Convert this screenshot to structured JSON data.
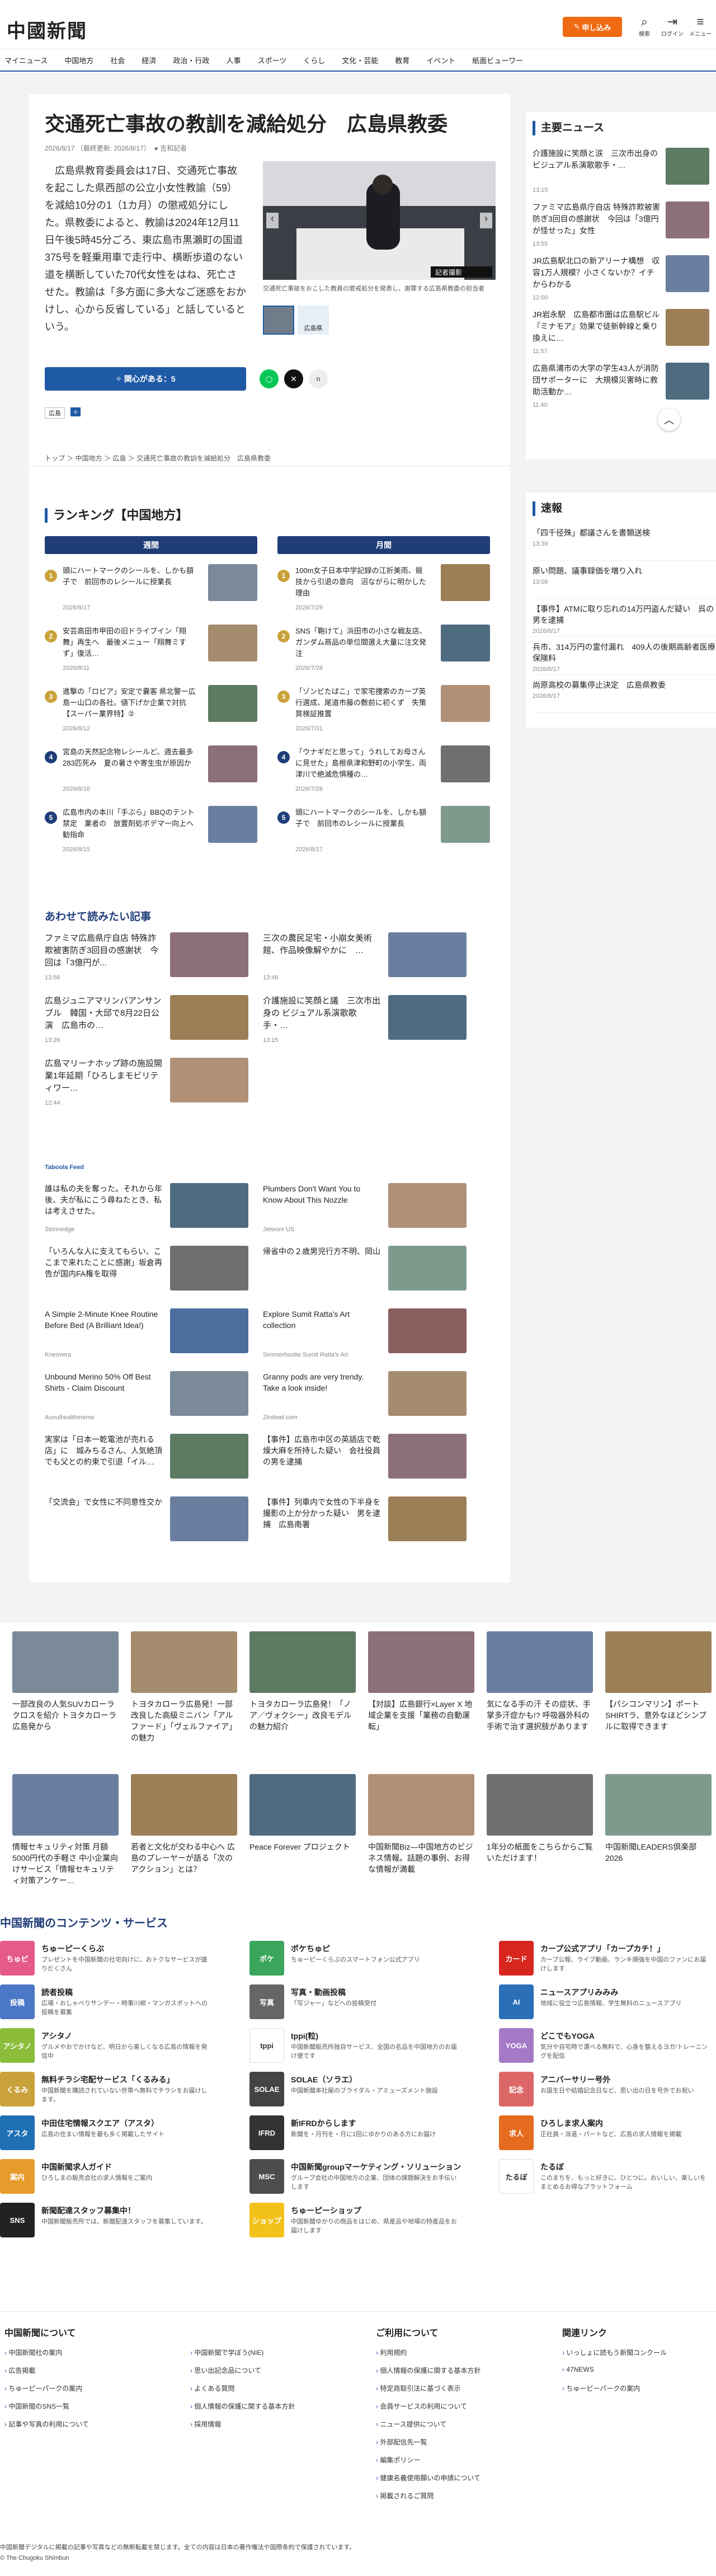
{
  "header": {
    "logo": "中國新聞",
    "subscribe": "申し込み",
    "icons": [
      {
        "glyph": "⌕",
        "label": "検索"
      },
      {
        "glyph": "⇥",
        "label": "ログイン"
      },
      {
        "glyph": "≡",
        "label": "メニュー"
      }
    ]
  },
  "nav": [
    "マイニュース",
    "中国地方",
    "社会",
    "経済",
    "政治・行政",
    "人事",
    "スポーツ",
    "くらし",
    "文化・芸能",
    "教育",
    "イベント",
    "紙面ビューワー"
  ],
  "article": {
    "title": "交通死亡事故の教訓を減給処分　広島県教委",
    "date": "2026/8/17",
    "updated": "（最終更新: 2026/8/17）",
    "author": "吉和記者",
    "body": "広島県教育委員会は17日、交通死亡事故を起こした県西部の公立小女性教諭（59）を減給10分の1（1カ月）の懲戒処分にした。県教委によると、教諭は2024年12月11日午後5時45分ごろ、東広島市黒瀬町の国道375号を軽乗用車で走行中、横断歩道のない道を横断していた70代女性をはね、死亡させた。教諭は「多方面に多大なご迷惑をおかけし、心から反省している」と話しているという。",
    "photo_credit": "記者撮影",
    "caption": "交通死亡事故をおこした教員の懲戒処分を発表し、謝罪する広島県教委の担当者",
    "thumb_label": "広島県",
    "like_label": "関心がある：5",
    "tag_badge": "広島"
  },
  "breadcrumb": "トップ ＞ 中国地方 ＞ 広島 ＞ 交通死亡事故の教訓を減給処分　広島県教委",
  "ranking": {
    "title": "ランキング【中国地方】",
    "col1": "週間",
    "col2": "月間",
    "weekly": [
      {
        "t": "頭にハートマークのシールを、しかも額子で　前回市のレシールに授業長",
        "d": "2026/8/17"
      },
      {
        "t": "安芸高田市甲田の旧ドライブイン「翔舞」再生へ　最後メニュー「翔舞ミすず」復活…",
        "d": "2026/8/11"
      },
      {
        "t": "進撃の「ロピア」安定で嚢客 県北警ー広島ー山口の各社。値下げか企業で対抗【スーパー業界特】②",
        "d": "2026/8/12"
      },
      {
        "t": "宮島の天然記念物レシールど、週去最多283匹死み　夏の暑さや寄生虫が原因か",
        "d": "2026/8/16"
      },
      {
        "t": "広島市内の本川「手ぶら」BBQのテント禁定　業者の　放置剤処ボデマ一向上へ勧指命",
        "d": "2026/8/15"
      }
    ],
    "monthly": [
      {
        "t": "100m女子日本中学記録の江折美雨、競技から引退の意向　沼ながらに明かした理由",
        "d": "2026/7/29"
      },
      {
        "t": "SNS「鞄けて」浜田市の小さな戦友店、ガンダム商品の単位間選え大量に注文発注",
        "d": "2026/7/28"
      },
      {
        "t": "「ゾンビたばこ」で家宅捜索のカープ英行選成、尾道市藤の敷前に初くず　失策質検証推置",
        "d": "2026/7/31"
      },
      {
        "t": "「ウナギだと思って」うれしてお母さんに見せた」島根県津和野町の小学生、両津川で絶滅危惧種の…",
        "d": "2026/7/26"
      },
      {
        "t": "頭にハートマークのシールを、しかも額子で　前回市のレシールに授業長",
        "d": "2026/8/17"
      }
    ]
  },
  "related": {
    "title": "あわせて読みたい記事",
    "items": [
      {
        "t": "ファミマ広島県庁自店 特殊詐欺被害防ぎ3回目の感謝状　今回は「3億円が...",
        "d": "13:56"
      },
      {
        "t": "三次の農民足宅・小崩女美術館、作品映像解やかに　…",
        "d": "13:46"
      },
      {
        "t": "広島ジュニアマリンバアンサンブル　韓国・大邱で8月22日公演　広島市の…",
        "d": "13:26"
      },
      {
        "t": "介護施設に笑顔と議　三次市出身の ビジュアル系演歌歌手・…",
        "d": "13:15"
      },
      {
        "t": "広島マリーナホップ跡の施設開業1年延期「ひろしまモビリティワー…",
        "d": "12:44"
      }
    ]
  },
  "taboola": {
    "label": "Taboola Feed",
    "items": [
      {
        "t": "誰は私の夫を奪った。それから年後、夫が私にこう尋ねたとき、私は考えさせた。",
        "s": "Stonnedge"
      },
      {
        "t": "Plumbers Don't Want You to Know About This Nozzle",
        "s": "Jetworx US"
      },
      {
        "t": "「いろんな人に支えてもらい、ここまで来れたことに感謝」坂倉再告が国内FA権を取得",
        "s": ""
      },
      {
        "t": "帰省中の２歳男児行方不明、岡山",
        "s": ""
      },
      {
        "t": "A Simple 2-Minute Knee Routine Before Bed (A Brilliant Idea!)",
        "s": "Kneovera"
      },
      {
        "t": "Explore Sumit Ratta's Art collection",
        "s": "Simmerhootie Sumit Ratta's Art"
      },
      {
        "t": "Unbound Merino 50% Off Best Shirts - Claim Discount",
        "s": "Aunulhealthmeme"
      },
      {
        "t": "Granny pods are very trendy. Take a look inside!",
        "s": "Zindwel.com"
      },
      {
        "t": "実家は「日本一乾電池が売れる店」に　城みちるさん、人気絶頂でも父との約束で引退「イル…",
        "s": ""
      },
      {
        "t": "【事件】広島市中区の英語店で乾燥大麻を所持した疑い　会社役員の男を逮捕",
        "s": ""
      },
      {
        "t": "「交流会」で女性に不同意性交か",
        "s": ""
      },
      {
        "t": "【事件】列車内で女性の下半身を撮影の上か分かった疑い　男を逮捕　広島南署",
        "s": ""
      }
    ]
  },
  "main_news": {
    "title": "主要ニュース",
    "items": [
      {
        "t": "介護施設に笑顔と涙　三次市出身の ビジュアル系演歌歌手・…",
        "d": "13:15"
      },
      {
        "t": "ファミマ広島県庁自店 特殊詐欺被害防ぎ3回目の感謝状　今回は「3億円が怪せった」女性",
        "d": "13:55"
      },
      {
        "t": "JR広島駅北口の新アリーナ構想　収容1万人規模？小さくないか？イチからわかる",
        "d": "12:00"
      },
      {
        "t": "JR岩永駅　広島都市圏は広島駅ビル『ミナモア』効果で徒新幹線と乗り換えに…",
        "d": "11:57"
      },
      {
        "t": "広島県浦市の大学の学生43人が消防団サポーターに　大規模災害時に救助活動か…",
        "d": "11:40"
      }
    ]
  },
  "sokuho": {
    "title": "速報",
    "items": [
      {
        "t": "「四千径殊」都議さんを書類送検",
        "d": "13:39"
      },
      {
        "t": "原い問題、議事録価を増り入れ",
        "d": "13:08"
      },
      {
        "t": "【事件】ATMに取り忘れの14万円盗んだ疑い　呉の男を逮捕",
        "d": "2026/8/17"
      },
      {
        "t": "兵市、314万円の霊付漏れ　409人の後期高齢者医療保険料",
        "d": "2026/8/17"
      },
      {
        "t": "尚原高校の募集停止決定　広島県教委",
        "d": "2026/8/17"
      }
    ]
  },
  "promo1": [
    {
      "t": "一部改良の人気SUVカローラ クロスを紹介 トヨタカローラ広島発から"
    },
    {
      "t": "トヨタカローラ広島発！一部改良した高級ミニバン「アルファード」「ヴェルファイア」の魅力"
    },
    {
      "t": "トヨタカローラ広島発！「ノア／ヴォクシー」改良モデルの魅力紹介"
    },
    {
      "t": "【対談】広島銀行×Layer X 地域企業を支援「業務の自動運転」"
    },
    {
      "t": "気になる手の汗 その症状、手掌多汗症かも!? 呼吸器外科の手術で治す選択肢があります"
    },
    {
      "t": "【パシコンマリン】ポートSHIRTラ、意外なほどシンプルに取得できます"
    }
  ],
  "promo2": [
    {
      "t": "情報セキュリティ対策 月額5000円代の手軽さ 中小企業向けサービス「情報セキュリティ対策アンケー…"
    },
    {
      "t": "若者と文化が交わる中心へ 広島のプレーヤーが語る「次のアクション」とは？"
    },
    {
      "t": "Peace Forever プロジェクト"
    },
    {
      "t": "中国新聞Biz―中国地方のビジネス情報。話題の事例、お得な情報が満載"
    },
    {
      "t": "1年分の紙面をこちらからご覧いただけます！"
    },
    {
      "t": "中国新聞LEADERS倶楽部2026"
    }
  ],
  "services": {
    "title": "中国新聞のコンテンツ・サービス",
    "items": [
      {
        "ic": "ちゅピ",
        "t": "ちゅーピーくらぶ",
        "s": "プレゼントを中国新聞の社宅向けに、おトクなサービスが盛りだくさん",
        "c": "#e55a8a"
      },
      {
        "ic": "ポケ",
        "t": "ポケちゅピ",
        "s": "ちゅーピーくらぶのスマートフォン公式アプリ",
        "c": "#3aa55b"
      },
      {
        "ic": "カード",
        "t": "カープ公式アプリ「カープカチ！」",
        "s": "カープ公報、ライブ動画、ランキ順強を中国のファンにお届けします",
        "c": "#d8261e"
      },
      {
        "ic": "投稿",
        "t": "読者投稿",
        "s": "広場・おしゃべりサンデー・時事川柳・マンガスポットへの投稿を募集",
        "c": "#4a77c6"
      },
      {
        "ic": "写真",
        "t": "写真・動画投稿",
        "s": "「写ジャー」などへの投稿受付",
        "c": "#666"
      },
      {
        "ic": "AI",
        "t": "ニュースアプリみみみ",
        "s": "地域に役立つ広島情報、学生無料のニュースアプリ",
        "c": "#2a6fb8"
      },
      {
        "ic": "アシタノ",
        "t": "アシタノ",
        "s": "グルメやおでかけなど、明日から楽しくなる広島の情報を発信中",
        "c": "#8bbd3a"
      },
      {
        "ic": "tppi",
        "t": "tppi(粒)",
        "s": "中国新聞販売所独自サービス、全国の名品を中国地方のお届け便です",
        "c": "#fff"
      },
      {
        "ic": "YOGA",
        "t": "どこでもYOGA",
        "s": "気分や自宅時で選べる無料で、心身を整えるヨガ/トレーニングを配信",
        "c": "#a47ac7"
      },
      {
        "ic": "くるみ",
        "t": "無料チラシ宅配サービス「くるみる」",
        "s": "中国新聞を購読されていない世帯へ無料でチラシをお届けします。",
        "c": "#c9a23b"
      },
      {
        "ic": "SOLAE",
        "t": "SOLAE（ソラエ）",
        "s": "中国新聞本社屋のブライダル・アミューズメント施設",
        "c": "#444"
      },
      {
        "ic": "記念",
        "t": "アニバーサリー号外",
        "s": "お誕生日や結婚記念日など、思い出の日を号外でお祝い",
        "c": "#d66"
      },
      {
        "ic": "アスタ",
        "t": "中田住宅情報スクエア（アスタ）",
        "s": "広島の住まい情報を最も多く掲載したサイト",
        "c": "#1f6fb5"
      },
      {
        "ic": "IFRD",
        "t": "新IFRDからします",
        "s": "新聞を・月刊を・月に1回にゆかりのある方にお届け",
        "c": "#333"
      },
      {
        "ic": "求人",
        "t": "ひろしま求人案内",
        "s": "正社員・派遣・パートなど、広島の求人情報を掲載",
        "c": "#e56b1f"
      },
      {
        "ic": "案内",
        "t": "中国新聞求人ガイド",
        "s": "ひろしまの販売会社の求人情報をご案内",
        "c": "#e79b2a"
      },
      {
        "ic": "MSC",
        "t": "中国新聞groupマーケティング・ソリューション",
        "s": "グループ会社の中国地方の企業、団体の課題解決をお手伝いします",
        "c": "#4d4d4d"
      },
      {
        "ic": "たるぼ",
        "t": "たるぼ",
        "s": "このまちを、もっと好きに、ひとつに。おいしい、楽しいをまとめるお得なプラットフォーム",
        "c": "#fff"
      },
      {
        "ic": "SNS",
        "t": "新聞配達スタッフ募集中！",
        "s": "中国新聞販売所では、新聞配達スタッフを募集しています。",
        "c": "#222"
      },
      {
        "ic": "ショップ",
        "t": "ちゅーピーショップ",
        "s": "中国新聞ゆかりの商品をはじめ、県産品や地場の特産品をお届けします",
        "c": "#f2c21b"
      }
    ]
  },
  "footer": {
    "h1": "中国新聞について",
    "h2": "ご利用について",
    "h3": "関連リンク",
    "c1": [
      "中国新聞社の案内",
      "広告掲載",
      "ちゅーピーパークの案内",
      "中国新聞のSNS一覧",
      "記事や写真の利用について"
    ],
    "c2": [
      "中国新聞で学ぼう(NIE)",
      "思い出記念品について",
      "よくある質問",
      "個人情報の保護に関する基本方針",
      "採用情報"
    ],
    "c3": [
      "利用規約",
      "個人情報の保護に関する基本方針",
      "特定商取引法に基づく表示",
      "会員サービスの利用について",
      "ニュース提供について",
      "外部配信先一覧",
      "編集ポリシー",
      "健康名義使用願いの申請について",
      "掲載されるご質問"
    ],
    "c4": [
      "いっしょに読もう新聞コンクール",
      "47NEWS",
      "ちゅーピーパークの案内"
    ],
    "copy": "中国新聞デジタルに掲載の記事や写真などの無断転載を禁じます。全ての内容は日本の著作権法や国際条約で保護されています。",
    "c": "© The Chugoku Shimbun"
  },
  "colors": {
    "brand_blue": "#1f5aa6",
    "navy": "#1f3d78",
    "orange": "#ef6a13"
  }
}
